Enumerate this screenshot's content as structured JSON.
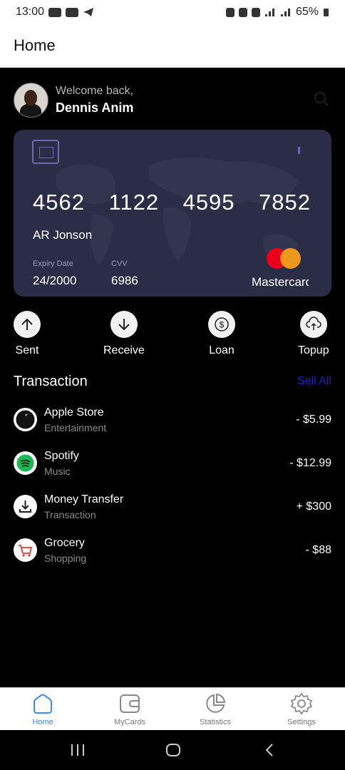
{
  "status_bar": {
    "time": "13:00",
    "battery": "65%"
  },
  "app_bar": {
    "title": "Home"
  },
  "profile": {
    "greeting": "Welcome back,",
    "name": "Dennis Anim"
  },
  "card": {
    "number_groups": [
      "4562",
      "1122",
      "4595",
      "7852"
    ],
    "holder": "AR Jonson",
    "expiry_label": "Expiry Date",
    "expiry_value": "24/2000",
    "cvv_label": "CVV",
    "cvv_value": "6986",
    "network": "Mastercard"
  },
  "actions": [
    {
      "label": "Sent",
      "icon": "arrow-up-icon"
    },
    {
      "label": "Receive",
      "icon": "arrow-down-icon"
    },
    {
      "label": "Loan",
      "icon": "dollar-coin-icon"
    },
    {
      "label": "Topup",
      "icon": "cloud-upload-icon"
    }
  ],
  "transactions": {
    "title": "Transaction",
    "see_all": "Sell All",
    "items": [
      {
        "title": "Apple Store",
        "subtitle": "Entertainment",
        "amount": "- $5.99",
        "icon": "apple-icon"
      },
      {
        "title": "Spotify",
        "subtitle": "Music",
        "amount": "- $12.99",
        "icon": "spotify-icon"
      },
      {
        "title": "Money Transfer",
        "subtitle": "Transaction",
        "amount": "+ $300",
        "icon": "download-icon"
      },
      {
        "title": "Grocery",
        "subtitle": "Shopping",
        "amount": "- $88",
        "icon": "shopping-cart-icon"
      }
    ]
  },
  "bottom_nav": {
    "items": [
      {
        "label": "Home",
        "icon": "home-icon",
        "active": true
      },
      {
        "label": "MyCards",
        "icon": "wallet-icon",
        "active": false
      },
      {
        "label": "Statistics",
        "icon": "pie-chart-icon",
        "active": false
      },
      {
        "label": "Settings",
        "icon": "gear-icon",
        "active": false
      }
    ]
  },
  "colors": {
    "accent": "#3d89f5",
    "see_all": "#1a23cc",
    "card_bg": "#2b2c46"
  }
}
